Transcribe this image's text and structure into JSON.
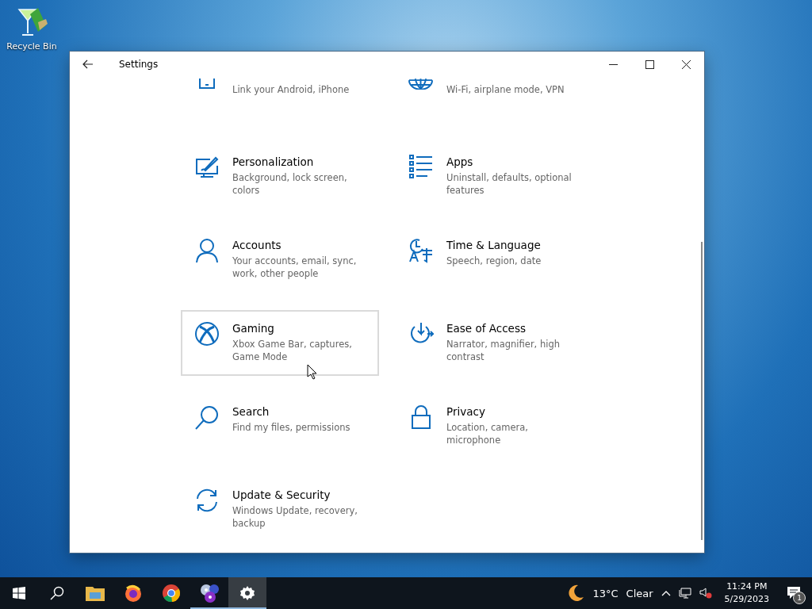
{
  "desktop": {
    "icons": [
      {
        "label": "Recycle Bin"
      }
    ]
  },
  "window": {
    "title": "Settings",
    "items": [
      {
        "kind": "partial",
        "description": "Link your Android, iPhone",
        "hovered": false
      },
      {
        "kind": "partial",
        "description": "Wi-Fi, airplane mode, VPN",
        "hovered": false
      },
      {
        "kind": "full",
        "title": "Personalization",
        "description": "Background, lock screen, colors",
        "hovered": false
      },
      {
        "kind": "full",
        "title": "Apps",
        "description": "Uninstall, defaults, optional features",
        "hovered": false
      },
      {
        "kind": "full",
        "title": "Accounts",
        "description": "Your accounts, email, sync, work, other people",
        "hovered": false
      },
      {
        "kind": "full",
        "title": "Time & Language",
        "description": "Speech, region, date",
        "hovered": false
      },
      {
        "kind": "full",
        "title": "Gaming",
        "description": "Xbox Game Bar, captures, Game Mode",
        "hovered": true
      },
      {
        "kind": "full",
        "title": "Ease of Access",
        "description": "Narrator, magnifier, high contrast",
        "hovered": false
      },
      {
        "kind": "full",
        "title": "Search",
        "description": "Find my files, permissions",
        "hovered": false
      },
      {
        "kind": "full",
        "title": "Privacy",
        "description": "Location, camera, microphone",
        "hovered": false
      },
      {
        "kind": "full",
        "title": "Update & Security",
        "description": "Windows Update, recovery, backup",
        "hovered": false
      }
    ]
  },
  "taskbar": {
    "apps": [
      {
        "running": false,
        "active": false
      },
      {
        "running": false,
        "active": false
      },
      {
        "running": false,
        "active": false
      },
      {
        "running": true,
        "active": false
      },
      {
        "running": true,
        "active": true
      }
    ],
    "weather": {
      "temperature": "13°C",
      "condition": "Clear"
    },
    "clock": {
      "time": "11:24 PM",
      "date": "5/29/2023"
    },
    "notifications": {
      "count": "1"
    }
  }
}
